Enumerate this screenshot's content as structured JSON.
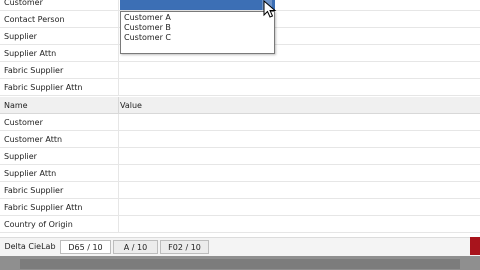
{
  "top_section": {
    "rows": [
      "Customer",
      "Contact Person",
      "Supplier",
      "Supplier Attn",
      "Fabric Supplier",
      "Fabric Supplier Attn"
    ]
  },
  "dropdown": {
    "options": [
      "Customer A",
      "Customer B",
      "Customer C"
    ]
  },
  "grid_header": {
    "name": "Name",
    "value": "Value"
  },
  "bottom_section": {
    "rows": [
      "Customer",
      "Customer Attn",
      "Supplier",
      "Supplier Attn",
      "Fabric Supplier",
      "Fabric Supplier Attn",
      "Country of Origin"
    ]
  },
  "tabs": [
    "Delta CieLab",
    "D65 / 10",
    "A / 10",
    "F02 / 10"
  ],
  "colors": {
    "selection": "#3c6fb5",
    "accent_red": "#a8141c"
  },
  "icons": {
    "cursor": "mouse-pointer-icon"
  }
}
